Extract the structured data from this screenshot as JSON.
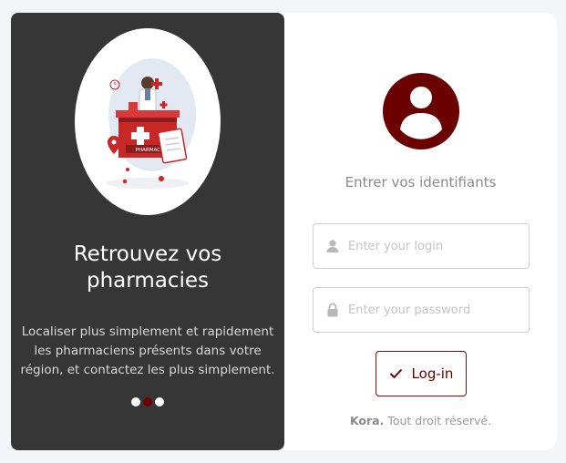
{
  "colors": {
    "brand": "#6b0000",
    "panel_bg": "#363636",
    "page_bg": "#f4f5f8"
  },
  "left_panel": {
    "title": "Retrouvez vos pharmacies",
    "description": "Localiser plus simplement et rapidement les pharmaciens présents dans votre région, et contactez les plus simplement.",
    "illustration_label": "PHARMACY",
    "carousel": {
      "count": 3,
      "active_index": 2
    }
  },
  "login_form": {
    "avatar_icon": "user-icon",
    "subtitle": "Entrer vos identifiants",
    "login_field": {
      "icon": "user-icon",
      "placeholder": "Enter your login",
      "value": ""
    },
    "password_field": {
      "icon": "lock-icon",
      "placeholder": "Enter your password",
      "value": ""
    },
    "submit": {
      "icon": "check-icon",
      "label": "Log-in"
    },
    "footer": {
      "brand": "Kora.",
      "text": " Tout droit réservé."
    }
  }
}
